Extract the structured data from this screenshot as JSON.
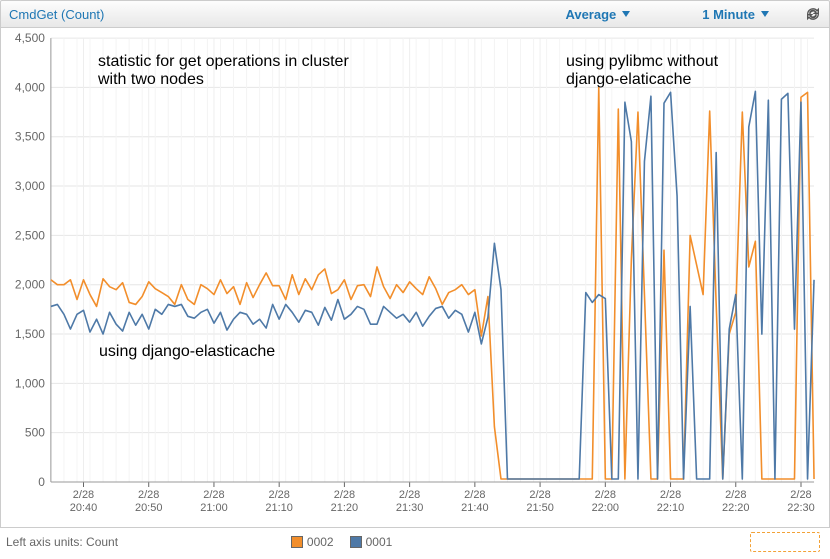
{
  "toolbar": {
    "title": "CmdGet (Count)",
    "aggregation_label": "Average",
    "period_label": "1 Minute"
  },
  "annotations": {
    "title_lines": "statistic for get operations in cluster\nwith two nodes",
    "left_caption": "using django-elasticache",
    "right_caption": "using pylibmc without\ndjango-elaticache"
  },
  "axis": {
    "left_units": "Left axis units:  Count"
  },
  "legend": {
    "series_a": "0002",
    "series_b": "0001"
  },
  "colors": {
    "series_a": "#f28e2b",
    "series_b": "#4e79a7"
  },
  "chart_data": {
    "type": "line",
    "ylabel": "",
    "ylim": [
      0,
      4500
    ],
    "yticks": [
      0,
      500,
      1000,
      1500,
      2000,
      2500,
      3000,
      3500,
      4000,
      4500
    ],
    "xticks_major": [
      "2/28\n20:40",
      "2/28\n20:50",
      "2/28\n21:00",
      "2/28\n21:10",
      "2/28\n21:20",
      "2/28\n21:30",
      "2/28\n21:40",
      "2/28\n21:50",
      "2/28\n22:00",
      "2/28\n22:10",
      "2/28\n22:20",
      "2/28\n22:30"
    ],
    "x": [
      "20:35",
      "20:36",
      "20:37",
      "20:38",
      "20:39",
      "20:40",
      "20:41",
      "20:42",
      "20:43",
      "20:44",
      "20:45",
      "20:46",
      "20:47",
      "20:48",
      "20:49",
      "20:50",
      "20:51",
      "20:52",
      "20:53",
      "20:54",
      "20:55",
      "20:56",
      "20:57",
      "20:58",
      "20:59",
      "21:00",
      "21:01",
      "21:02",
      "21:03",
      "21:04",
      "21:05",
      "21:06",
      "21:07",
      "21:08",
      "21:09",
      "21:10",
      "21:11",
      "21:12",
      "21:13",
      "21:14",
      "21:15",
      "21:16",
      "21:17",
      "21:18",
      "21:19",
      "21:20",
      "21:21",
      "21:22",
      "21:23",
      "21:24",
      "21:25",
      "21:26",
      "21:27",
      "21:28",
      "21:29",
      "21:30",
      "21:31",
      "21:32",
      "21:33",
      "21:34",
      "21:35",
      "21:36",
      "21:37",
      "21:38",
      "21:39",
      "21:40",
      "21:41",
      "21:42",
      "21:43",
      "21:44",
      "21:45",
      "21:46",
      "21:47",
      "21:48",
      "21:49",
      "21:50",
      "21:51",
      "21:52",
      "21:53",
      "21:54",
      "21:55",
      "21:56",
      "21:57",
      "21:58",
      "21:59",
      "22:00",
      "22:01",
      "22:02",
      "22:03",
      "22:04",
      "22:05",
      "22:06",
      "22:07",
      "22:08",
      "22:09",
      "22:10",
      "22:11",
      "22:12",
      "22:13",
      "22:14",
      "22:15",
      "22:16",
      "22:17",
      "22:18",
      "22:19",
      "22:20",
      "22:21",
      "22:22",
      "22:23",
      "22:24",
      "22:25",
      "22:26",
      "22:27",
      "22:28",
      "22:29",
      "22:30",
      "22:31",
      "22:32"
    ],
    "series": [
      {
        "name": "0002",
        "color": "#f28e2b",
        "values": [
          2050,
          2000,
          2000,
          2050,
          1850,
          2050,
          1900,
          1780,
          2060,
          1980,
          1950,
          2020,
          1820,
          1800,
          1880,
          2030,
          1960,
          1920,
          1880,
          1800,
          2000,
          1850,
          1800,
          2000,
          1960,
          1900,
          2050,
          1910,
          1980,
          1800,
          2020,
          1870,
          2000,
          2120,
          1990,
          1990,
          1850,
          2100,
          1900,
          2060,
          1950,
          2100,
          2160,
          1910,
          1950,
          2050,
          1850,
          1990,
          2000,
          1880,
          2180,
          1980,
          1860,
          2000,
          1920,
          2030,
          1960,
          1900,
          2080,
          1960,
          1800,
          1920,
          1950,
          2000,
          1900,
          1950,
          1480,
          1880,
          560,
          30,
          30,
          30,
          30,
          30,
          30,
          30,
          30,
          30,
          30,
          30,
          30,
          30,
          30,
          30,
          4000,
          30,
          30,
          3780,
          30,
          2260,
          3750,
          1900,
          30,
          30,
          2350,
          30,
          30,
          30,
          2500,
          2200,
          1900,
          3760,
          1800,
          30,
          1500,
          1720,
          3750,
          2180,
          2440,
          30,
          30,
          30,
          30,
          30,
          30,
          3900,
          3950,
          30
        ]
      },
      {
        "name": "0001",
        "color": "#4e79a7",
        "values": [
          1780,
          1800,
          1700,
          1550,
          1700,
          1740,
          1520,
          1650,
          1500,
          1720,
          1600,
          1530,
          1720,
          1590,
          1700,
          1550,
          1750,
          1700,
          1800,
          1780,
          1800,
          1680,
          1660,
          1720,
          1750,
          1610,
          1720,
          1540,
          1650,
          1720,
          1700,
          1600,
          1650,
          1560,
          1800,
          1650,
          1800,
          1720,
          1620,
          1740,
          1720,
          1590,
          1770,
          1640,
          1850,
          1650,
          1700,
          1780,
          1750,
          1600,
          1600,
          1780,
          1720,
          1660,
          1700,
          1620,
          1720,
          1580,
          1680,
          1760,
          1780,
          1660,
          1740,
          1700,
          1520,
          1720,
          1400,
          1670,
          2420,
          1950,
          30,
          30,
          30,
          30,
          30,
          30,
          30,
          30,
          30,
          30,
          30,
          30,
          1920,
          1820,
          1900,
          1860,
          30,
          30,
          3850,
          3450,
          30,
          3250,
          3910,
          30,
          3840,
          3950,
          2900,
          30,
          1780,
          30,
          30,
          30,
          3340,
          30,
          1550,
          1900,
          30,
          3600,
          3960,
          1500,
          3870,
          30,
          3880,
          3940,
          1550,
          3850,
          30,
          2050
        ]
      }
    ]
  }
}
